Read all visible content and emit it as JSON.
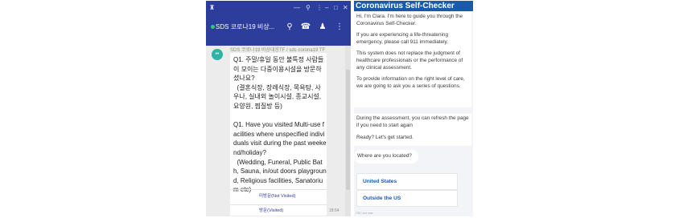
{
  "chat_app": {
    "titlebar_icons": [
      "app-icon",
      "minimize-icon",
      "pin-icon",
      "more-icon",
      "minimize-window-icon",
      "maximize-icon",
      "close-icon"
    ],
    "title": "SDS 코로나19 비상...",
    "header_buttons": [
      "search-icon",
      "call-icon",
      "add-member-icon",
      "more-vertical-icon"
    ],
    "message": {
      "sender": "SDS 코로나19 비상대응TF / sds corona19 TF",
      "text": "Q1. 주말/휴일 동안 불특정 사람들이 모이는 다중이용시설을 방문하셨나요?\n  (결혼식장, 장례식장, 목욕탕, 사우나, 실내외 놀이시설, 종교시설, 요양원, 찜질방 등)\n\nQ1. Have you visited Multi-use facilities where unspecified individuals visit during the past weekend/holiday?\n  (Wedding, Funeral, Public Bath, Sauna, in/out doors playground, Religious facilities, Sanatorium etc)",
      "choices": [
        "미방문(Not Visited)",
        "방문(Visited)"
      ],
      "time": "18:54"
    }
  },
  "self_checker": {
    "title": "Coronavirus Self-Checker",
    "intro_paragraphs": [
      "Hi, I'm Clara. I'm here to guide you through the Coronavirus Self-Checker.",
      "If you are experiencing a life-threatening emergency, please call 911 immediately.",
      "This system does not replace the judgment of healthcare professionals or the performance of any clinical assessment.",
      "To provide information on the right level of care, we are going to ask you a series of questions."
    ],
    "followup_paragraphs": [
      "During the assessment, you can refresh the page if you need to start again",
      "Ready? Let's get started."
    ],
    "question": "Where are you located?",
    "options": [
      "United States",
      "Outside the US"
    ],
    "footer": "CDC bot now"
  }
}
